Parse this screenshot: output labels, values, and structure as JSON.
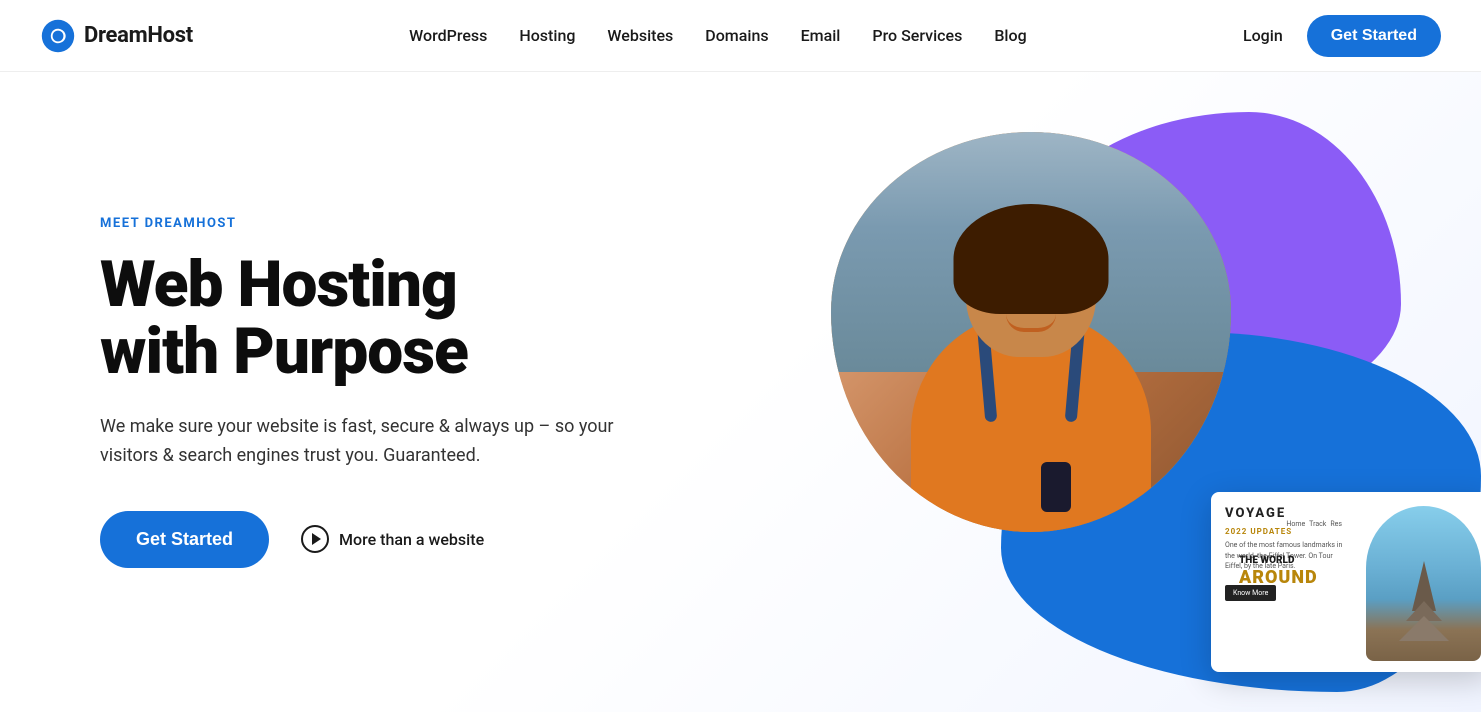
{
  "brand": {
    "name": "DreamHost",
    "logo_text": "DreamHost"
  },
  "nav": {
    "links": [
      {
        "label": "WordPress",
        "id": "wordpress"
      },
      {
        "label": "Hosting",
        "id": "hosting"
      },
      {
        "label": "Websites",
        "id": "websites"
      },
      {
        "label": "Domains",
        "id": "domains"
      },
      {
        "label": "Email",
        "id": "email"
      },
      {
        "label": "Pro Services",
        "id": "pro-services"
      },
      {
        "label": "Blog",
        "id": "blog"
      }
    ],
    "login_label": "Login",
    "cta_label": "Get Started"
  },
  "hero": {
    "eyebrow": "MEET DREAMHOST",
    "title_line1": "Web Hosting",
    "title_line2": "with Purpose",
    "subtitle": "We make sure your website is fast, secure & always up – so your visitors & search engines trust you. Guaranteed.",
    "cta_label": "Get Started",
    "secondary_label": "More than a website"
  },
  "voyage_card": {
    "brand": "VOYAGE",
    "updates_label": "2022 UPDATES",
    "body": "One of the most famous landmarks in the world, the Eiffel Tower. On Tour Eiffel, by the late Paris.",
    "know_more": "Know More",
    "world_label": "THE WORLD",
    "around_label": "AROUND"
  }
}
